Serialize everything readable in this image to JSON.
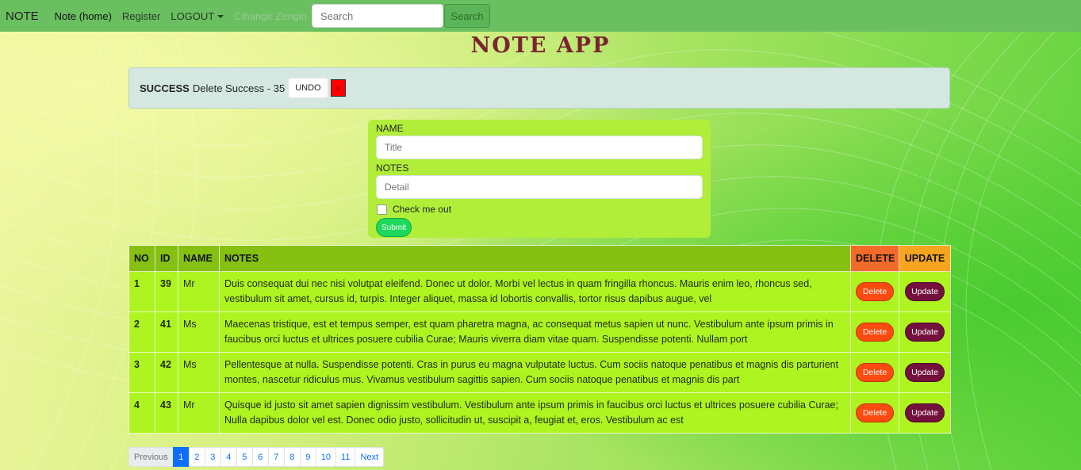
{
  "navbar": {
    "brand": "NOTE",
    "links": [
      {
        "label": "Note (home)"
      },
      {
        "label": "Register"
      },
      {
        "label": "LOGOUT"
      },
      {
        "label": "Cihangir Zengin"
      }
    ],
    "search_placeholder": "Search",
    "search_button": "Search"
  },
  "title": "NOTE APP",
  "alert": {
    "strong": "SUCCESS",
    "message": "Delete Success - 35",
    "undo_label": "UNDO",
    "close_label": "x"
  },
  "form": {
    "name_label": "NAME",
    "name_placeholder": "Title",
    "notes_label": "NOTES",
    "notes_placeholder": "Detail",
    "checkbox_label": "Check me out",
    "submit_label": "Submit"
  },
  "table": {
    "headers": {
      "no": "NO",
      "id": "ID",
      "name": "NAME",
      "notes": "NOTES",
      "delete": "DELETE",
      "update": "UPDATE"
    },
    "delete_label": "Delete",
    "update_label": "Update",
    "rows": [
      {
        "no": "1",
        "id": "39",
        "name": "Mr",
        "notes": "Duis consequat dui nec nisi volutpat eleifend. Donec ut dolor. Morbi vel lectus in quam fringilla rhoncus. Mauris enim leo, rhoncus sed, vestibulum sit amet, cursus id, turpis. Integer aliquet, massa id lobortis convallis, tortor risus dapibus augue, vel"
      },
      {
        "no": "2",
        "id": "41",
        "name": "Ms",
        "notes": "Maecenas tristique, est et tempus semper, est quam pharetra magna, ac consequat metus sapien ut nunc. Vestibulum ante ipsum primis in faucibus orci luctus et ultrices posuere cubilia Curae; Mauris viverra diam vitae quam. Suspendisse potenti. Nullam port"
      },
      {
        "no": "3",
        "id": "42",
        "name": "Ms",
        "notes": "Pellentesque at nulla. Suspendisse potenti. Cras in purus eu magna vulputate luctus. Cum sociis natoque penatibus et magnis dis parturient montes, nascetur ridiculus mus. Vivamus vestibulum sagittis sapien. Cum sociis natoque penatibus et magnis dis part"
      },
      {
        "no": "4",
        "id": "43",
        "name": "Mr",
        "notes": "Quisque id justo sit amet sapien dignissim vestibulum. Vestibulum ante ipsum primis in faucibus orci luctus et ultrices posuere cubilia Curae; Nulla dapibus dolor vel est. Donec odio justo, sollicitudin ut, suscipit a, feugiat et, eros. Vestibulum ac est"
      }
    ]
  },
  "pagination": {
    "previous": "Previous",
    "pages": [
      "1",
      "2",
      "3",
      "4",
      "5",
      "6",
      "7",
      "8",
      "9",
      "10",
      "11"
    ],
    "active": "1",
    "next": "Next"
  }
}
